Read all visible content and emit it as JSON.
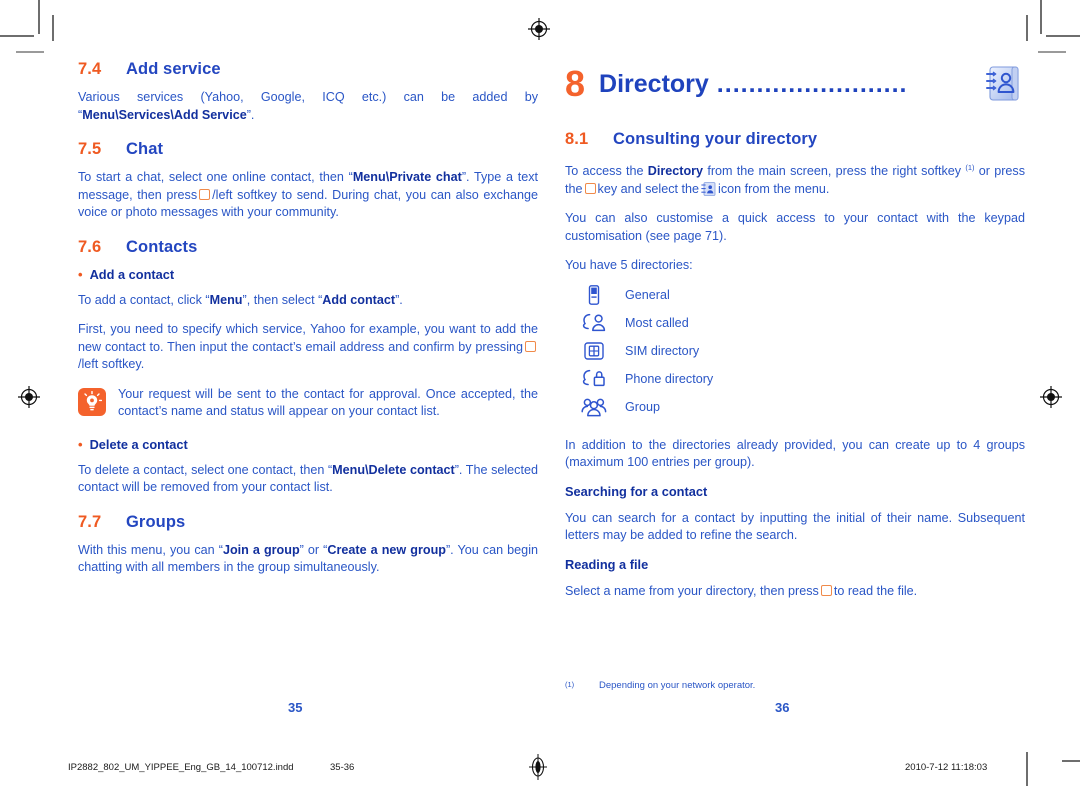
{
  "document": {
    "left_page_number": "35",
    "right_page_number": "36"
  },
  "left_page": {
    "sections": [
      {
        "number": "7.4",
        "title": "Add service"
      },
      {
        "number": "7.5",
        "title": "Chat"
      },
      {
        "number": "7.6",
        "title": "Contacts"
      },
      {
        "number": "7.7",
        "title": "Groups"
      }
    ],
    "add_service_body_1": "Various services (Yahoo, Google, ICQ etc.) can be added by “",
    "add_service_bold_1": "Menu\\Services\\Add Service",
    "add_service_body_2": "”.",
    "chat_body_1": "To start a chat, select one online contact, then “",
    "chat_bold_1": "Menu\\Private chat",
    "chat_body_2": "”. Type a text message, then press",
    "chat_body_3": "/left softkey to send. During chat, you can also exchange voice or photo messages with your community.",
    "add_contact_heading": "Add a contact",
    "add_contact_body_1": "To add a contact, click “",
    "add_contact_bold_1": "Menu",
    "add_contact_body_2": "”, then select “",
    "add_contact_bold_2": "Add contact",
    "add_contact_body_3": "”.",
    "add_contact_body_4": "First, you need to specify which service, Yahoo for example, you want to add the new contact to. Then input the contact’s email address and confirm by pressing",
    "add_contact_body_5": "/left softkey.",
    "tip_text": "Your request will be sent to the contact for approval. Once accepted, the contact’s name and status will appear on your contact list.",
    "delete_contact_heading": "Delete a contact",
    "delete_contact_body_1": "To delete a contact, select one contact, then “",
    "delete_contact_bold_1": "Menu\\Delete contact",
    "delete_contact_body_2": "”. The selected contact will be removed from your contact list.",
    "groups_body_1": "With this menu, you can “",
    "groups_bold_1": "Join a group",
    "groups_body_2": "” or “",
    "groups_bold_2": "Create a new group",
    "groups_body_3": "”. You can begin chatting with all members in the group simultaneously."
  },
  "right_page": {
    "chapter_number": "8",
    "chapter_title": "Directory",
    "chapter_dots": "........................",
    "chapter_icon": "directory-book-icon",
    "section": {
      "number": "8.1",
      "title": "Consulting your directory"
    },
    "access_body_1": "To access the ",
    "access_bold_1": "Directory",
    "access_body_2": " from the main screen, press the right softkey ",
    "access_footnote_mark": "(1)",
    "access_body_3": " or press the",
    "access_body_4": "key and select the",
    "access_body_5": "icon from the menu.",
    "customise_body": "You can also customise a quick access to your contact with the keypad customisation (see page 71).",
    "directories_intro": "You have 5 directories:",
    "directories": [
      {
        "label": "General",
        "icon": "phone-handset-icon"
      },
      {
        "label": "Most called",
        "icon": "call-person-icon"
      },
      {
        "label": "SIM directory",
        "icon": "sim-card-icon"
      },
      {
        "label": "Phone directory",
        "icon": "phone-lock-icon"
      },
      {
        "label": "Group",
        "icon": "group-people-icon"
      }
    ],
    "groups_body": "In addition to the directories already provided, you can create up to 4 groups (maximum 100 entries per group).",
    "searching_heading": "Searching for a contact",
    "searching_body": "You can search for a contact by inputting the initial of their name. Subsequent letters may be added to refine the search.",
    "reading_heading": "Reading a file",
    "reading_body_1": "Select a name from your directory, then press",
    "reading_body_2": "to read the file.",
    "footnote_mark": "(1)",
    "footnote_text": "Depending on your network operator."
  },
  "print_bar": {
    "filename": "IP2882_802_UM_YIPPEE_Eng_GB_14_100712.indd",
    "page_range": "35-36",
    "timestamp": "2010-7-12   11:18:03"
  },
  "colors": {
    "accent_orange": "#f4622c",
    "heading_blue": "#1f43bd",
    "body_blue": "#2a56c6"
  }
}
